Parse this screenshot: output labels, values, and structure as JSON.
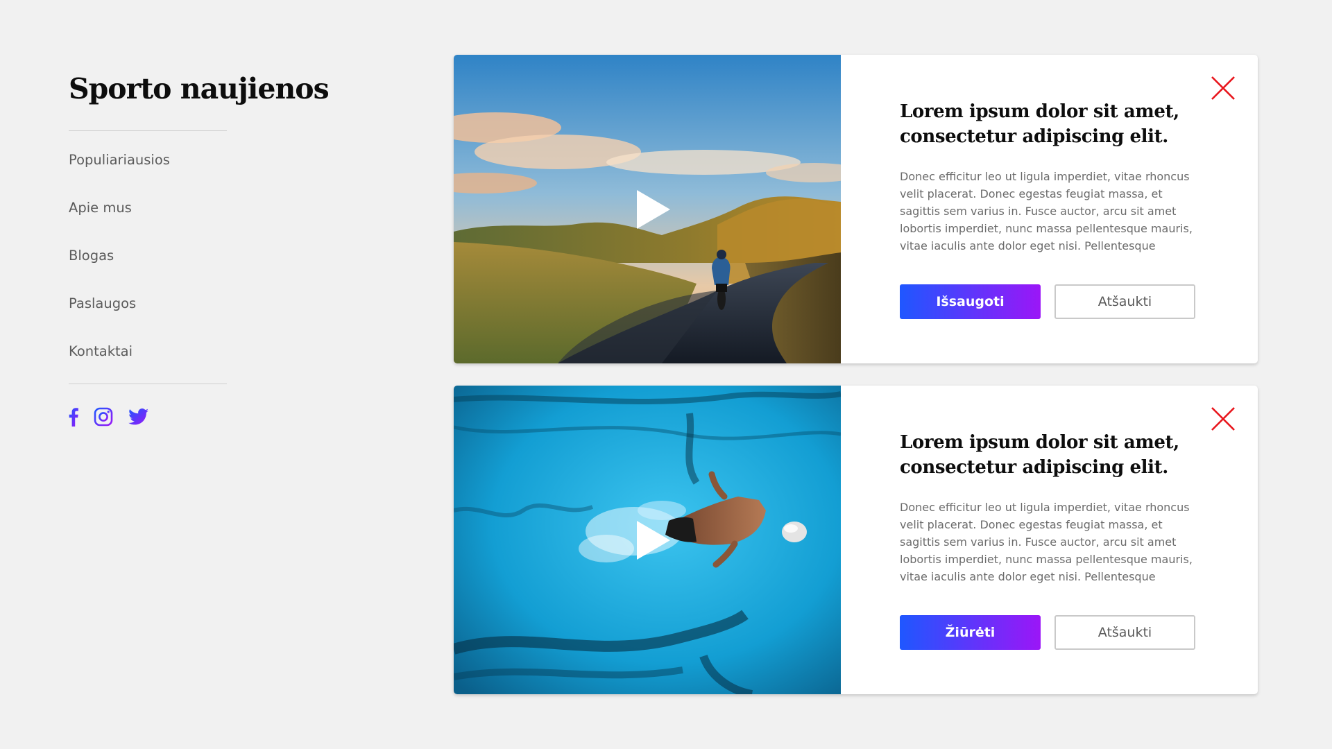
{
  "sidebar": {
    "title": "Sporto naujienos",
    "nav": [
      "Populiariausios",
      "Apie mus",
      "Blogas",
      "Paslaugos",
      "Kontaktai"
    ],
    "social": [
      "facebook-icon",
      "instagram-icon",
      "twitter-icon"
    ]
  },
  "colors": {
    "accent_gradient_start": "#1f57ff",
    "accent_gradient_end": "#9b16f7",
    "close": "#e8141b",
    "background": "#f1f1f1"
  },
  "cards": [
    {
      "image": "cyclist-on-mountain-road",
      "title": "Lorem ipsum dolor sit amet, consectetur adipiscing elit.",
      "body": "Donec efficitur leo ut ligula imperdiet, vitae rhoncus velit placerat. Donec egestas feugiat massa, et sagittis sem varius in. Fusce auctor, arcu sit amet lobortis imperdiet, nunc massa pellentesque mauris, vitae iaculis ante dolor eget nisi. Pellentesque",
      "primary_label": "Išsaugoti",
      "secondary_label": "Atšaukti"
    },
    {
      "image": "swimmer-in-pool",
      "title": "Lorem ipsum dolor sit amet, consectetur adipiscing elit.",
      "body": "Donec efficitur leo ut ligula imperdiet, vitae rhoncus velit placerat. Donec egestas feugiat massa, et sagittis sem varius in. Fusce auctor, arcu sit amet lobortis imperdiet, nunc massa pellentesque mauris, vitae iaculis ante dolor eget nisi. Pellentesque",
      "primary_label": "Žiūrėti",
      "secondary_label": "Atšaukti"
    }
  ]
}
